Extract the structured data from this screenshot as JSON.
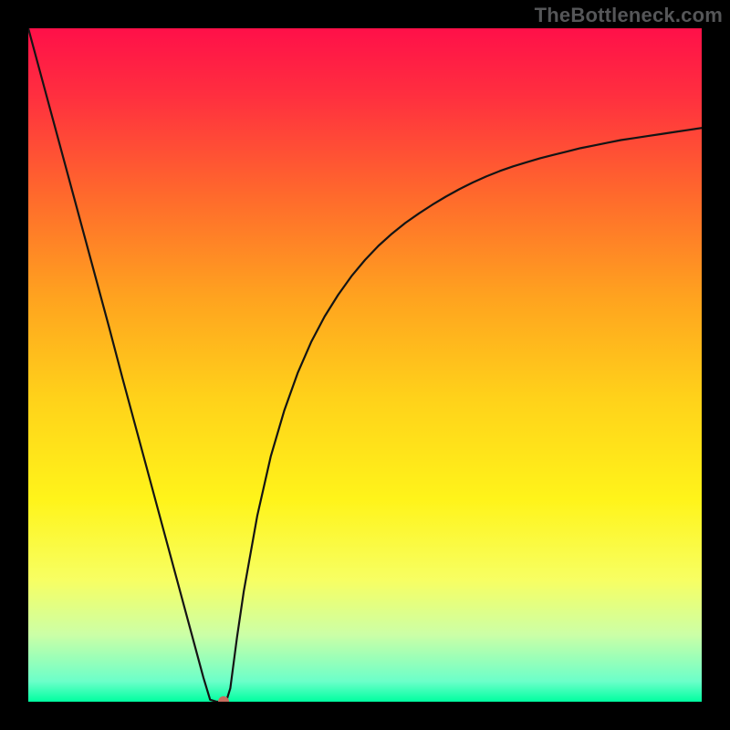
{
  "watermark": "TheBottleneck.com",
  "chart_data": {
    "type": "line",
    "title": "",
    "xlabel": "",
    "ylabel": "",
    "xlim": [
      0,
      100
    ],
    "ylim": [
      0,
      100
    ],
    "x": [
      0,
      2,
      4,
      6,
      8,
      10,
      12,
      14,
      16,
      18,
      20,
      22,
      24,
      26,
      27,
      28,
      28.5,
      29,
      29.5,
      30,
      31,
      32,
      34,
      36,
      38,
      40,
      42,
      44,
      46,
      48,
      50,
      52,
      54,
      56,
      58,
      60,
      62,
      64,
      66,
      68,
      70,
      72,
      74,
      76,
      78,
      80,
      82,
      84,
      86,
      88,
      90,
      92,
      94,
      96,
      98,
      100
    ],
    "values": [
      100.0,
      92.6,
      85.2,
      77.8,
      70.4,
      63.0,
      55.6,
      48.0,
      40.6,
      33.2,
      25.8,
      18.4,
      11.0,
      3.6,
      0.3,
      0.0,
      0.0,
      0.0,
      0.4,
      2.0,
      9.6,
      16.4,
      27.6,
      36.4,
      43.2,
      48.8,
      53.4,
      57.2,
      60.4,
      63.2,
      65.6,
      67.7,
      69.5,
      71.1,
      72.5,
      73.8,
      75.0,
      76.1,
      77.1,
      78.0,
      78.8,
      79.5,
      80.1,
      80.7,
      81.2,
      81.7,
      82.2,
      82.6,
      83.0,
      83.4,
      83.7,
      84.0,
      84.3,
      84.6,
      84.9,
      85.2
    ],
    "marker_point": {
      "x": 29,
      "y": 0
    },
    "gradient_stops": [
      {
        "offset": 0.0,
        "color": "#ff1049"
      },
      {
        "offset": 0.1,
        "color": "#ff2f3f"
      },
      {
        "offset": 0.25,
        "color": "#ff6a2c"
      },
      {
        "offset": 0.4,
        "color": "#ffa31f"
      },
      {
        "offset": 0.55,
        "color": "#ffd21a"
      },
      {
        "offset": 0.7,
        "color": "#fff41a"
      },
      {
        "offset": 0.82,
        "color": "#f7ff63"
      },
      {
        "offset": 0.9,
        "color": "#ccffa6"
      },
      {
        "offset": 0.97,
        "color": "#6bffc9"
      },
      {
        "offset": 1.0,
        "color": "#00ffa0"
      }
    ],
    "style": {
      "line_color": "#141414",
      "line_width": 2.2,
      "marker_fill": "#c86c5e",
      "marker_radius": 6
    }
  }
}
